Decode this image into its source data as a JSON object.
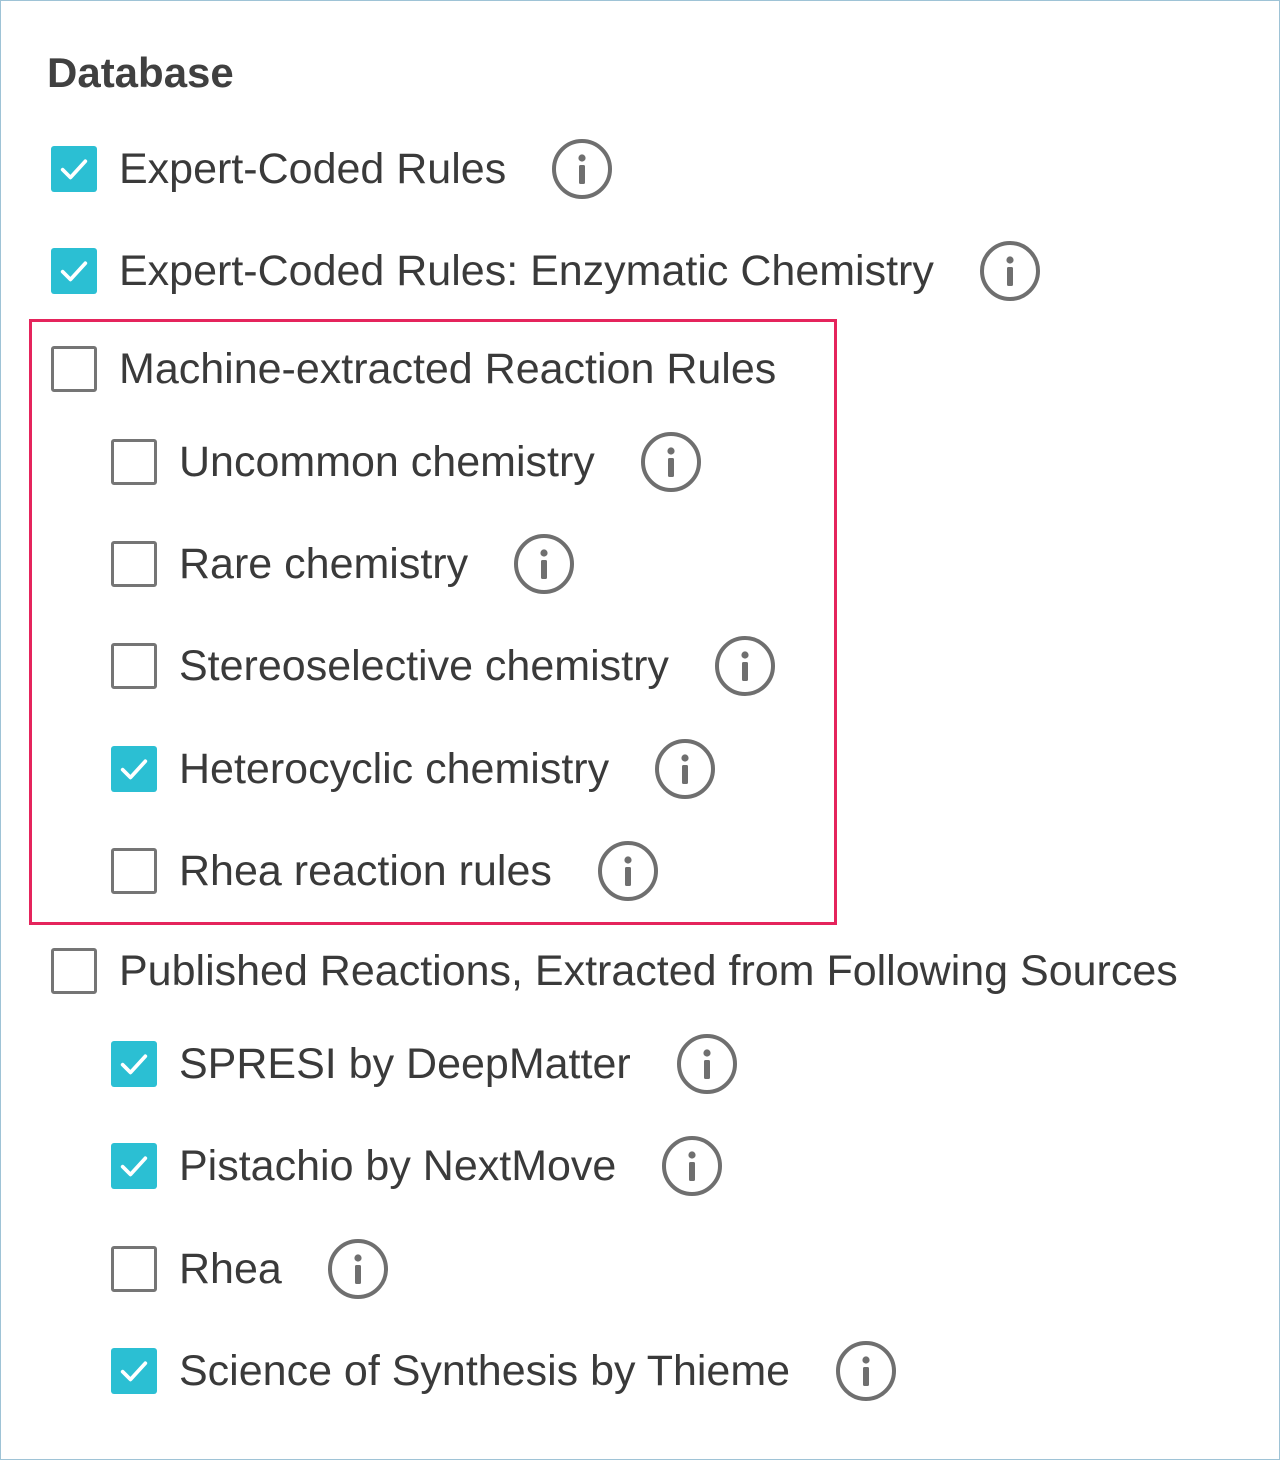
{
  "section": {
    "title": "Database"
  },
  "items": [
    {
      "label": "Expert-Coded Rules",
      "checked": true,
      "info": true
    },
    {
      "label": "Expert-Coded Rules: Enzymatic Chemistry",
      "checked": true,
      "info": true
    },
    {
      "label": "Machine-extracted Reaction Rules",
      "checked": false,
      "info": false
    },
    {
      "label": "Uncommon chemistry",
      "checked": false,
      "info": true
    },
    {
      "label": "Rare chemistry",
      "checked": false,
      "info": true
    },
    {
      "label": "Stereoselective chemistry",
      "checked": false,
      "info": true
    },
    {
      "label": "Heterocyclic chemistry",
      "checked": true,
      "info": true
    },
    {
      "label": "Rhea reaction rules",
      "checked": false,
      "info": true
    },
    {
      "label": "Published Reactions, Extracted from Following Sources",
      "checked": false,
      "info": false
    },
    {
      "label": "SPRESI by DeepMatter",
      "checked": true,
      "info": true
    },
    {
      "label": "Pistachio by NextMove",
      "checked": true,
      "info": true
    },
    {
      "label": "Rhea",
      "checked": false,
      "info": true
    },
    {
      "label": "Science of Synthesis by Thieme",
      "checked": true,
      "info": true
    }
  ],
  "colors": {
    "checked_fill": "#2bbfd3",
    "highlight_border": "#e5245c",
    "panel_border": "#9ec3d6"
  },
  "icons": {
    "check": "check-icon",
    "info": "info-icon"
  }
}
